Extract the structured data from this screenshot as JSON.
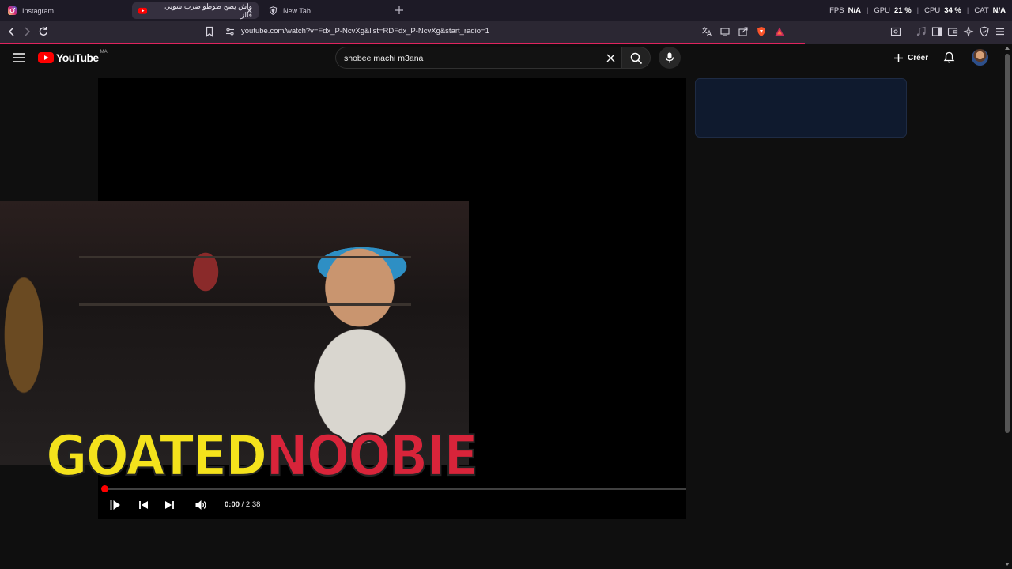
{
  "browser": {
    "tabs": [
      {
        "label": "Instagram",
        "icon": "instagram-icon",
        "active": false
      },
      {
        "label": "واش يصح طوطو ضرب شوبي فالز",
        "icon": "youtube-icon",
        "active": true
      },
      {
        "label": "New Tab",
        "icon": "shield-icon",
        "active": false
      }
    ],
    "stats": {
      "fps_label": "FPS",
      "fps_value": "N/A",
      "gpu_label": "GPU",
      "gpu_value": "21 %",
      "cpu_label": "CPU",
      "cpu_value": "34 %",
      "cat_label": "CAT",
      "cat_value": "N/A",
      "separator": "|"
    },
    "url": "youtube.com/watch?v=Fdx_P-NcvXg&list=RDFdx_P-NcvXg&start_radio=1",
    "accent_color": "#e0245e"
  },
  "youtube": {
    "logo_text": "YouTube",
    "region": "MA",
    "search": {
      "value": "shobee machi m3ana"
    },
    "create_label": "Créer"
  },
  "player": {
    "overlay_title_1": "GOATED",
    "overlay_title_2": "NOOBIE",
    "time_current": "0:00",
    "time_total": " / 2:38",
    "progress_fraction": 0.0
  }
}
